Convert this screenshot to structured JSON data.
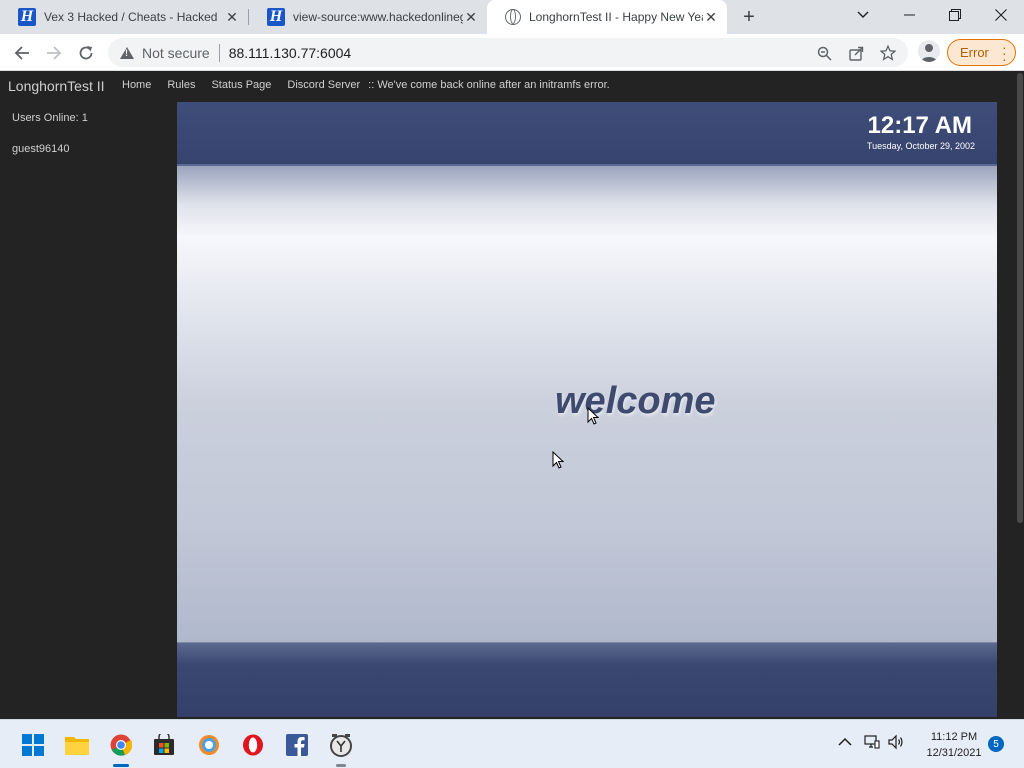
{
  "browser": {
    "tabs": [
      {
        "title": "Vex 3 Hacked / Cheats - Hacked",
        "favicon": "h-favicon",
        "active": false
      },
      {
        "title": "view-source:www.hackedonlineg",
        "favicon": "h-favicon",
        "active": false
      },
      {
        "title": "LonghornTest II - Happy New Yea",
        "favicon": "globe-icon",
        "active": true
      }
    ],
    "security_label": "Not secure",
    "url": "88.111.130.77:6004",
    "error_label": "Error"
  },
  "site": {
    "title": "LonghornTest II",
    "nav": [
      "Home",
      "Rules",
      "Status Page",
      "Discord Server"
    ],
    "announcement": ":: We've come back online after an initramfs error.",
    "users_online": "Users Online: 1",
    "user": "guest96140"
  },
  "screen": {
    "time": "12:17 AM",
    "date": "Tuesday, October 29, 2002",
    "welcome": "welcome"
  },
  "taskbar": {
    "time": "11:12 PM",
    "date": "12/31/2021",
    "notifications": "5",
    "apps": [
      "windows-start-icon",
      "file-explorer-icon",
      "chrome-icon",
      "microsoft-store-icon",
      "sync-app-icon",
      "opera-icon",
      "facebook-icon",
      "clock-app-icon"
    ]
  },
  "colors": {
    "accent": "#0067c0",
    "error": "#e37400",
    "longhorn_blue": "#3a4770"
  }
}
